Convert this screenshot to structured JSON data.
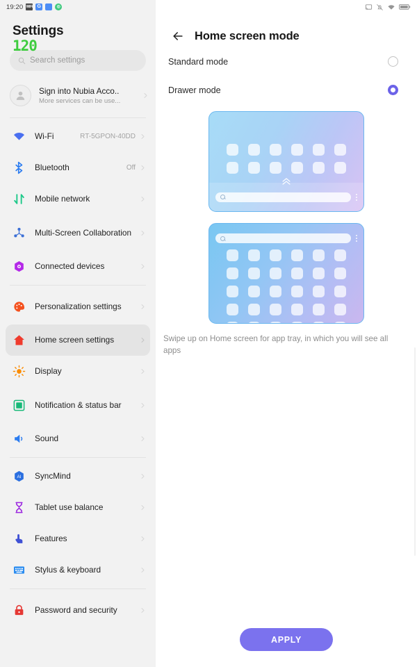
{
  "status_bar": {
    "time": "19:20",
    "left_icons": [
      "wifi-badge-icon",
      "google-icon",
      "app-square-icon",
      "chat-icon"
    ],
    "right_icons": [
      "screen-cast-icon",
      "bell-muted-icon",
      "wifi-icon",
      "battery-icon"
    ]
  },
  "overlay": {
    "fps": "120"
  },
  "sidebar": {
    "title": "Settings",
    "search": {
      "placeholder": "Search settings",
      "icon": "search-icon"
    },
    "account": {
      "title": "Sign into Nubia Acco..",
      "subtitle": "More services can be use...",
      "avatar_icon": "person-icon"
    },
    "items": [
      {
        "label": "Wi-Fi",
        "value": "RT-5GPON-40DD",
        "icon": "wifi-icon",
        "color": "#4a6ff0",
        "active": false
      },
      {
        "label": "Bluetooth",
        "value": "Off",
        "icon": "bluetooth-icon",
        "color": "#2b7cf0",
        "active": false
      },
      {
        "label": "Mobile network",
        "value": "",
        "icon": "mobile-network-icon",
        "color": "#1ec98a",
        "active": false
      },
      {
        "label": "Multi-Screen Collaboration",
        "value": "",
        "icon": "multi-screen-icon",
        "color": "#3b6fd6",
        "active": false
      },
      {
        "label": "Connected devices",
        "value": "",
        "icon": "connected-devices-icon",
        "color": "#b429e8",
        "active": false
      },
      {
        "label": "Personalization settings",
        "value": "",
        "icon": "palette-icon",
        "color": "#f4511e",
        "active": false
      },
      {
        "label": "Home screen settings",
        "value": "",
        "icon": "home-icon",
        "color": "#ef3b2d",
        "active": true
      },
      {
        "label": "Display",
        "value": "",
        "icon": "brightness-icon",
        "color": "#fb8c00",
        "active": false
      },
      {
        "label": "Notification & status bar",
        "value": "",
        "icon": "notification-bar-icon",
        "color": "#17b978",
        "active": false
      },
      {
        "label": "Sound",
        "value": "",
        "icon": "speaker-icon",
        "color": "#2b7cf0",
        "active": false
      },
      {
        "label": "SyncMind",
        "value": "",
        "icon": "syncmind-icon",
        "color": "#2b6fe0",
        "active": false
      },
      {
        "label": "Tablet use balance",
        "value": "",
        "icon": "hourglass-icon",
        "color": "#9c27e0",
        "active": false
      },
      {
        "label": "Features",
        "value": "",
        "icon": "tap-gesture-icon",
        "color": "#3f51d5",
        "active": false
      },
      {
        "label": "Stylus & keyboard",
        "value": "",
        "icon": "keyboard-icon",
        "color": "#2b8cf0",
        "active": false
      },
      {
        "label": "Password and security",
        "value": "",
        "icon": "lock-icon",
        "color": "#e53935",
        "active": false
      }
    ]
  },
  "main": {
    "back_icon": "back-arrow-icon",
    "title": "Home screen mode",
    "options": [
      {
        "label": "Standard mode",
        "selected": false
      },
      {
        "label": "Drawer mode",
        "selected": true
      }
    ],
    "illustrations": [
      {
        "name": "standard-mode-preview",
        "grid_rows": 2,
        "grid_cols": 6,
        "has_swipe_up_chevron": true,
        "search_position": "bottom",
        "chevron_icon": "double-chevron-up-icon",
        "search_icon": "search-icon",
        "more_icon": "more-vertical-icon"
      },
      {
        "name": "drawer-mode-preview",
        "grid_rows": 5,
        "grid_cols": 6,
        "has_swipe_up_chevron": false,
        "search_position": "top",
        "search_icon": "search-icon",
        "more_icon": "more-vertical-icon"
      }
    ],
    "description": "Swipe up on Home screen for app tray, in which you will see all apps",
    "apply_label": "APPLY"
  },
  "colors": {
    "accent": "#6c63e8",
    "apply_button": "#7b72ee",
    "fps_green": "#3fcc3f",
    "sidebar_bg": "#f2f2f2",
    "active_item_bg": "#e4e4e4"
  }
}
